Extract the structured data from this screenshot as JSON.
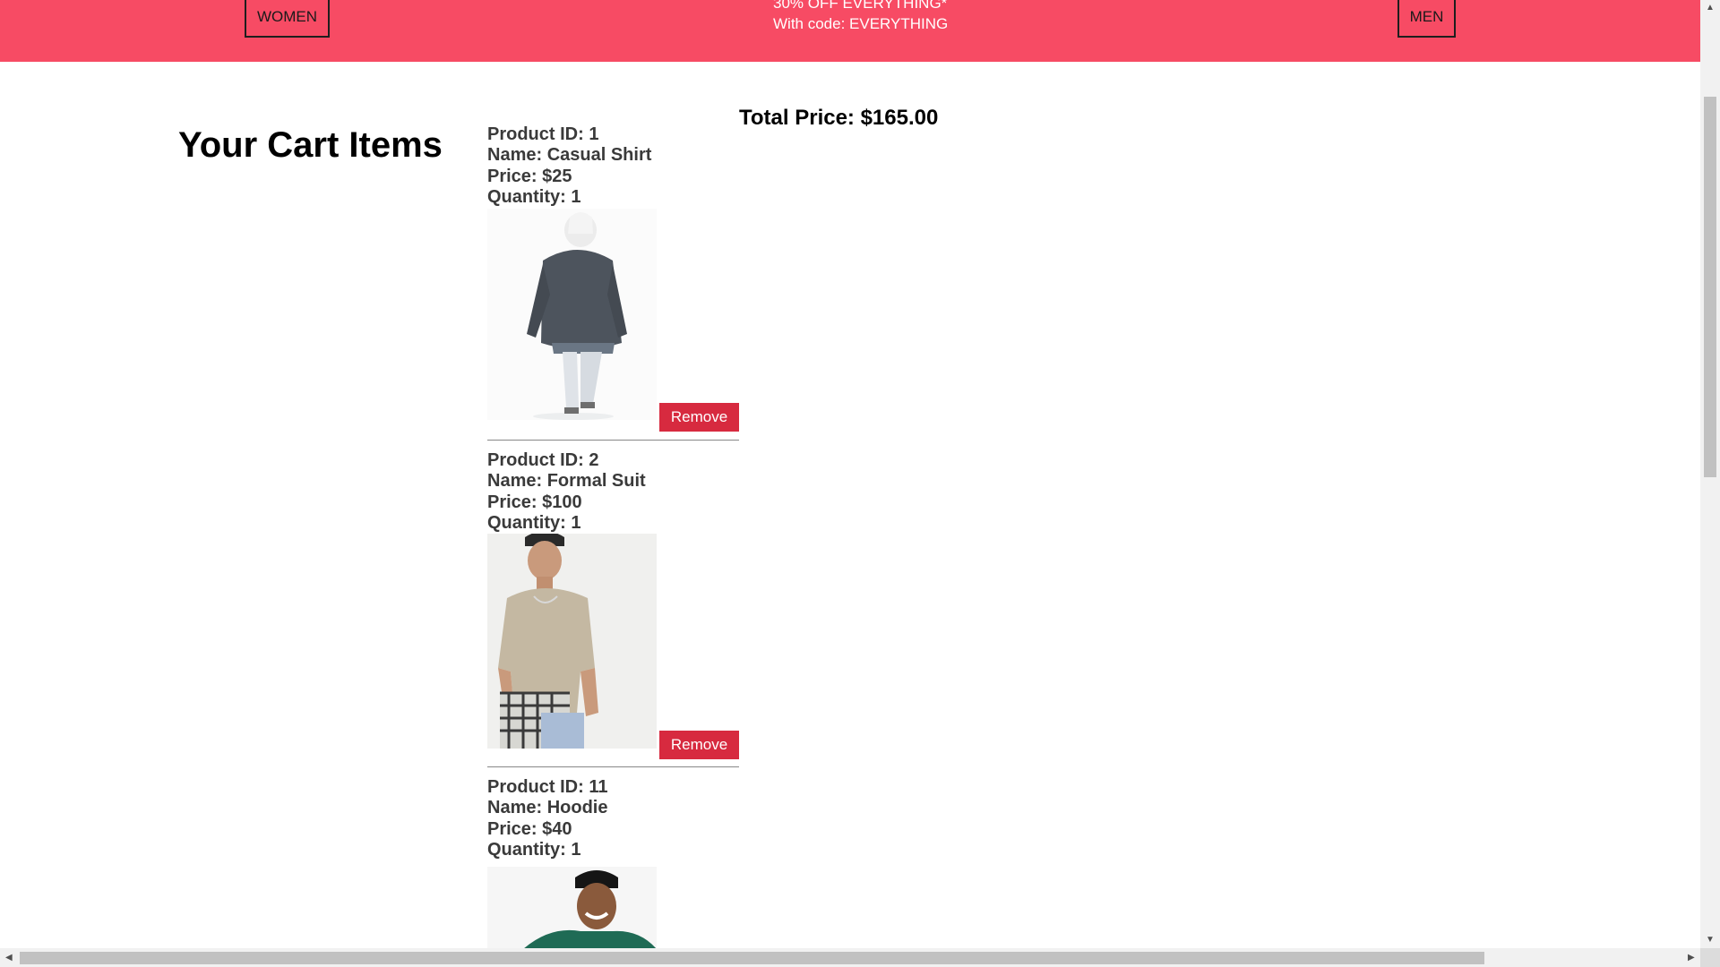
{
  "nav": {
    "women_label": "WOMEN",
    "men_label": "MEN"
  },
  "promo": {
    "line1": "30% OFF EVERYTHING*",
    "line2": "With code: EVERYTHING",
    "background": "#f74b64"
  },
  "cart": {
    "title": "Your Cart Items",
    "total_label": "Total Price: $165.00",
    "remove_label": "Remove",
    "remove_color": "#d72a3f",
    "items": [
      {
        "product_id": "Product ID: 1",
        "name": "Name: Casual Shirt",
        "price": "Price: $25",
        "quantity": "Quantity: 1"
      },
      {
        "product_id": "Product ID: 2",
        "name": "Name: Formal Suit",
        "price": "Price: $100",
        "quantity": "Quantity: 1"
      },
      {
        "product_id": "Product ID: 11",
        "name": "Name: Hoodie",
        "price": "Price: $40",
        "quantity": "Quantity: 1"
      }
    ]
  }
}
